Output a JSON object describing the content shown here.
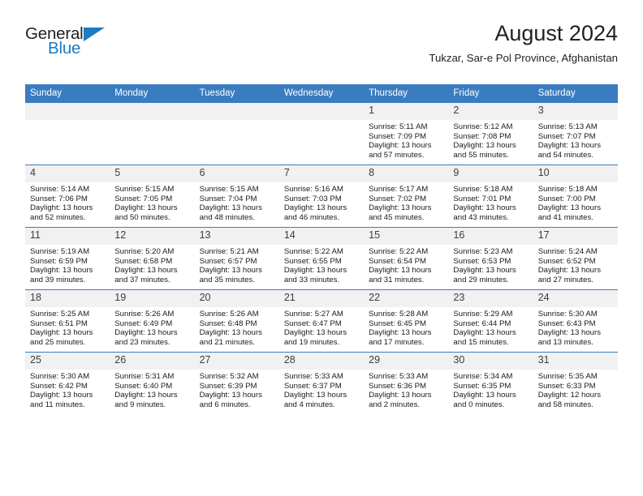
{
  "brand": {
    "name_part1": "General",
    "name_part2": "Blue",
    "accent_color": "#1b7bc4"
  },
  "header": {
    "title": "August 2024",
    "subtitle": "Tukzar, Sar-e Pol Province, Afghanistan"
  },
  "theme": {
    "header_blue": "#3a7cc0",
    "daynum_gray": "#f1f1f1",
    "text_color": "#231f20"
  },
  "weekday_headers": [
    "Sunday",
    "Monday",
    "Tuesday",
    "Wednesday",
    "Thursday",
    "Friday",
    "Saturday"
  ],
  "weeks": [
    [
      {
        "day": "",
        "sunrise": "",
        "sunset": "",
        "daylight_line1": "",
        "daylight_line2": ""
      },
      {
        "day": "",
        "sunrise": "",
        "sunset": "",
        "daylight_line1": "",
        "daylight_line2": ""
      },
      {
        "day": "",
        "sunrise": "",
        "sunset": "",
        "daylight_line1": "",
        "daylight_line2": ""
      },
      {
        "day": "",
        "sunrise": "",
        "sunset": "",
        "daylight_line1": "",
        "daylight_line2": ""
      },
      {
        "day": "1",
        "sunrise": "Sunrise: 5:11 AM",
        "sunset": "Sunset: 7:09 PM",
        "daylight_line1": "Daylight: 13 hours",
        "daylight_line2": "and 57 minutes."
      },
      {
        "day": "2",
        "sunrise": "Sunrise: 5:12 AM",
        "sunset": "Sunset: 7:08 PM",
        "daylight_line1": "Daylight: 13 hours",
        "daylight_line2": "and 55 minutes."
      },
      {
        "day": "3",
        "sunrise": "Sunrise: 5:13 AM",
        "sunset": "Sunset: 7:07 PM",
        "daylight_line1": "Daylight: 13 hours",
        "daylight_line2": "and 54 minutes."
      }
    ],
    [
      {
        "day": "4",
        "sunrise": "Sunrise: 5:14 AM",
        "sunset": "Sunset: 7:06 PM",
        "daylight_line1": "Daylight: 13 hours",
        "daylight_line2": "and 52 minutes."
      },
      {
        "day": "5",
        "sunrise": "Sunrise: 5:15 AM",
        "sunset": "Sunset: 7:05 PM",
        "daylight_line1": "Daylight: 13 hours",
        "daylight_line2": "and 50 minutes."
      },
      {
        "day": "6",
        "sunrise": "Sunrise: 5:15 AM",
        "sunset": "Sunset: 7:04 PM",
        "daylight_line1": "Daylight: 13 hours",
        "daylight_line2": "and 48 minutes."
      },
      {
        "day": "7",
        "sunrise": "Sunrise: 5:16 AM",
        "sunset": "Sunset: 7:03 PM",
        "daylight_line1": "Daylight: 13 hours",
        "daylight_line2": "and 46 minutes."
      },
      {
        "day": "8",
        "sunrise": "Sunrise: 5:17 AM",
        "sunset": "Sunset: 7:02 PM",
        "daylight_line1": "Daylight: 13 hours",
        "daylight_line2": "and 45 minutes."
      },
      {
        "day": "9",
        "sunrise": "Sunrise: 5:18 AM",
        "sunset": "Sunset: 7:01 PM",
        "daylight_line1": "Daylight: 13 hours",
        "daylight_line2": "and 43 minutes."
      },
      {
        "day": "10",
        "sunrise": "Sunrise: 5:18 AM",
        "sunset": "Sunset: 7:00 PM",
        "daylight_line1": "Daylight: 13 hours",
        "daylight_line2": "and 41 minutes."
      }
    ],
    [
      {
        "day": "11",
        "sunrise": "Sunrise: 5:19 AM",
        "sunset": "Sunset: 6:59 PM",
        "daylight_line1": "Daylight: 13 hours",
        "daylight_line2": "and 39 minutes."
      },
      {
        "day": "12",
        "sunrise": "Sunrise: 5:20 AM",
        "sunset": "Sunset: 6:58 PM",
        "daylight_line1": "Daylight: 13 hours",
        "daylight_line2": "and 37 minutes."
      },
      {
        "day": "13",
        "sunrise": "Sunrise: 5:21 AM",
        "sunset": "Sunset: 6:57 PM",
        "daylight_line1": "Daylight: 13 hours",
        "daylight_line2": "and 35 minutes."
      },
      {
        "day": "14",
        "sunrise": "Sunrise: 5:22 AM",
        "sunset": "Sunset: 6:55 PM",
        "daylight_line1": "Daylight: 13 hours",
        "daylight_line2": "and 33 minutes."
      },
      {
        "day": "15",
        "sunrise": "Sunrise: 5:22 AM",
        "sunset": "Sunset: 6:54 PM",
        "daylight_line1": "Daylight: 13 hours",
        "daylight_line2": "and 31 minutes."
      },
      {
        "day": "16",
        "sunrise": "Sunrise: 5:23 AM",
        "sunset": "Sunset: 6:53 PM",
        "daylight_line1": "Daylight: 13 hours",
        "daylight_line2": "and 29 minutes."
      },
      {
        "day": "17",
        "sunrise": "Sunrise: 5:24 AM",
        "sunset": "Sunset: 6:52 PM",
        "daylight_line1": "Daylight: 13 hours",
        "daylight_line2": "and 27 minutes."
      }
    ],
    [
      {
        "day": "18",
        "sunrise": "Sunrise: 5:25 AM",
        "sunset": "Sunset: 6:51 PM",
        "daylight_line1": "Daylight: 13 hours",
        "daylight_line2": "and 25 minutes."
      },
      {
        "day": "19",
        "sunrise": "Sunrise: 5:26 AM",
        "sunset": "Sunset: 6:49 PM",
        "daylight_line1": "Daylight: 13 hours",
        "daylight_line2": "and 23 minutes."
      },
      {
        "day": "20",
        "sunrise": "Sunrise: 5:26 AM",
        "sunset": "Sunset: 6:48 PM",
        "daylight_line1": "Daylight: 13 hours",
        "daylight_line2": "and 21 minutes."
      },
      {
        "day": "21",
        "sunrise": "Sunrise: 5:27 AM",
        "sunset": "Sunset: 6:47 PM",
        "daylight_line1": "Daylight: 13 hours",
        "daylight_line2": "and 19 minutes."
      },
      {
        "day": "22",
        "sunrise": "Sunrise: 5:28 AM",
        "sunset": "Sunset: 6:45 PM",
        "daylight_line1": "Daylight: 13 hours",
        "daylight_line2": "and 17 minutes."
      },
      {
        "day": "23",
        "sunrise": "Sunrise: 5:29 AM",
        "sunset": "Sunset: 6:44 PM",
        "daylight_line1": "Daylight: 13 hours",
        "daylight_line2": "and 15 minutes."
      },
      {
        "day": "24",
        "sunrise": "Sunrise: 5:30 AM",
        "sunset": "Sunset: 6:43 PM",
        "daylight_line1": "Daylight: 13 hours",
        "daylight_line2": "and 13 minutes."
      }
    ],
    [
      {
        "day": "25",
        "sunrise": "Sunrise: 5:30 AM",
        "sunset": "Sunset: 6:42 PM",
        "daylight_line1": "Daylight: 13 hours",
        "daylight_line2": "and 11 minutes."
      },
      {
        "day": "26",
        "sunrise": "Sunrise: 5:31 AM",
        "sunset": "Sunset: 6:40 PM",
        "daylight_line1": "Daylight: 13 hours",
        "daylight_line2": "and 9 minutes."
      },
      {
        "day": "27",
        "sunrise": "Sunrise: 5:32 AM",
        "sunset": "Sunset: 6:39 PM",
        "daylight_line1": "Daylight: 13 hours",
        "daylight_line2": "and 6 minutes."
      },
      {
        "day": "28",
        "sunrise": "Sunrise: 5:33 AM",
        "sunset": "Sunset: 6:37 PM",
        "daylight_line1": "Daylight: 13 hours",
        "daylight_line2": "and 4 minutes."
      },
      {
        "day": "29",
        "sunrise": "Sunrise: 5:33 AM",
        "sunset": "Sunset: 6:36 PM",
        "daylight_line1": "Daylight: 13 hours",
        "daylight_line2": "and 2 minutes."
      },
      {
        "day": "30",
        "sunrise": "Sunrise: 5:34 AM",
        "sunset": "Sunset: 6:35 PM",
        "daylight_line1": "Daylight: 13 hours",
        "daylight_line2": "and 0 minutes."
      },
      {
        "day": "31",
        "sunrise": "Sunrise: 5:35 AM",
        "sunset": "Sunset: 6:33 PM",
        "daylight_line1": "Daylight: 12 hours",
        "daylight_line2": "and 58 minutes."
      }
    ]
  ]
}
